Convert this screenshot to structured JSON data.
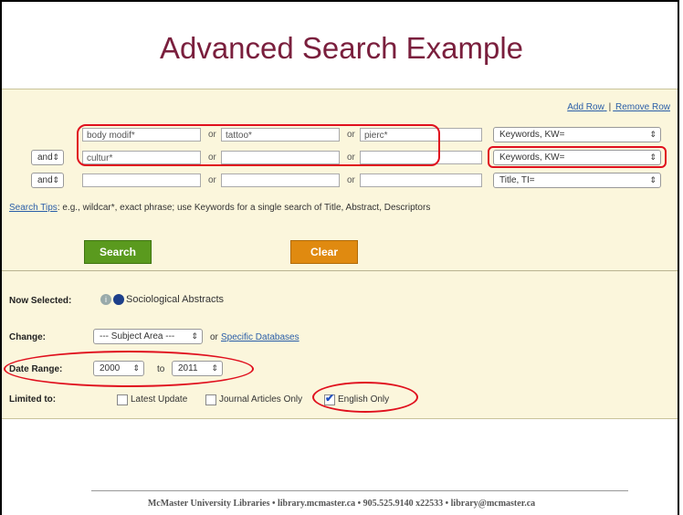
{
  "title": "Advanced Search Example",
  "row_links": {
    "add": "Add Row",
    "separator": "|",
    "remove": "Remove Row"
  },
  "rows": [
    {
      "connector": "",
      "terms": [
        "body modif*",
        "tattoo*",
        "pierc*"
      ],
      "ops": [
        "or",
        "or"
      ],
      "field": "Keywords, KW="
    },
    {
      "connector": "and",
      "terms": [
        "cultur*",
        "",
        ""
      ],
      "ops": [
        "or",
        "or"
      ],
      "field": "Keywords, KW="
    },
    {
      "connector": "and",
      "terms": [
        "",
        "",
        ""
      ],
      "ops": [
        "or",
        "or"
      ],
      "field": "Title, TI="
    }
  ],
  "tips": {
    "link": "Search Tips",
    "text": ": e.g., wildcar*, exact phrase; use Keywords for a single search of Title, Abstract, Descriptors"
  },
  "buttons": {
    "search": "Search",
    "clear": "Clear"
  },
  "now_selected": {
    "label": "Now Selected:",
    "value": "Sociological Abstracts"
  },
  "change": {
    "label": "Change:",
    "select": "--- Subject Area ---",
    "or": "or",
    "link": "Specific Databases"
  },
  "date_range": {
    "label": "Date Range:",
    "from": "2000",
    "to_label": "to",
    "to": "2011"
  },
  "limited_to": {
    "label": "Limited to:",
    "options": [
      {
        "label": "Latest Update",
        "checked": false
      },
      {
        "label": "Journal Articles Only",
        "checked": false
      },
      {
        "label": "English Only",
        "checked": true
      }
    ]
  },
  "footer": "McMaster University Libraries • library.mcmaster.ca • 905.525.9140 x22533 • library@mcmaster.ca",
  "colors": {
    "title": "#7a1f3d",
    "search_button": "#5a9a1e",
    "clear_button": "#e08a10",
    "highlight": "#e0101e",
    "panel": "#fbf6dc"
  }
}
